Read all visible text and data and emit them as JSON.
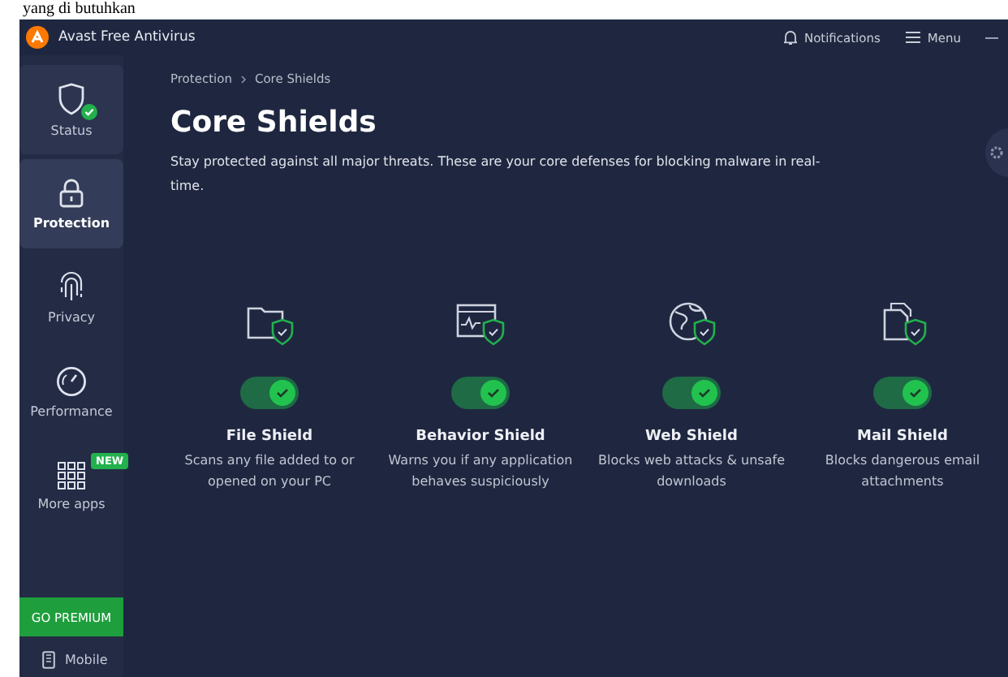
{
  "page_caption": "yang di butuhkan",
  "window": {
    "title": "Avast Free Antivirus",
    "notifications": "Notifications",
    "menu": "Menu"
  },
  "sidebar": {
    "items": [
      {
        "label": "Status",
        "selected": false,
        "badge_ok": true
      },
      {
        "label": "Protection",
        "selected": true
      },
      {
        "label": "Privacy",
        "selected": false
      },
      {
        "label": "Performance",
        "selected": false
      },
      {
        "label": "More apps",
        "selected": false,
        "badge": "NEW"
      }
    ],
    "premium_button": "GO PREMIUM",
    "mobile": "Mobile"
  },
  "breadcrumb": [
    "Protection",
    "Core Shields"
  ],
  "title": "Core Shields",
  "description": "Stay protected against all major threats. These are your core defenses for blocking malware in real-time.",
  "shields": [
    {
      "name": "File Shield",
      "on": true,
      "description": "Scans any file added to or opened on your PC"
    },
    {
      "name": "Behavior Shield",
      "on": true,
      "description": "Warns you if any application behaves suspiciously"
    },
    {
      "name": "Web Shield",
      "on": true,
      "description": "Blocks web attacks & unsafe downloads"
    },
    {
      "name": "Mail Shield",
      "on": true,
      "description": "Blocks dangerous email attachments"
    }
  ]
}
